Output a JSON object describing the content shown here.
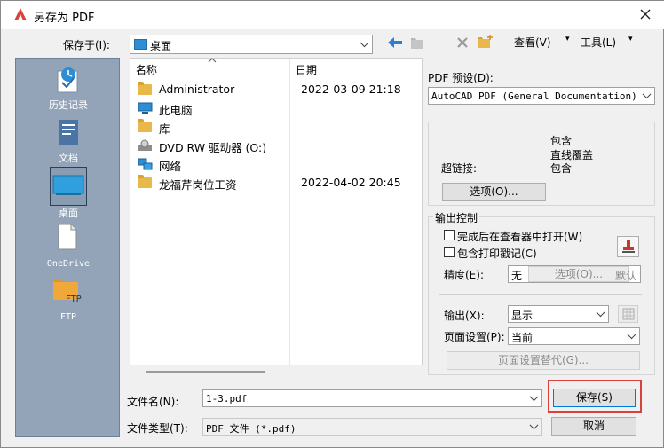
{
  "window": {
    "title": "另存为 PDF"
  },
  "toolbar": {
    "save_in_label": "保存于(I):",
    "location_value": "桌面",
    "view_menu": "查看(V)",
    "tools_menu": "工具(L)"
  },
  "places": [
    {
      "label": "历史记录",
      "icon": "history-icon"
    },
    {
      "label": "文档",
      "icon": "documents-icon"
    },
    {
      "label": "桌面",
      "icon": "desktop-icon"
    },
    {
      "label": "OneDrive",
      "icon": "onedrive-icon"
    },
    {
      "label": "FTP",
      "icon": "ftp-folder-icon"
    }
  ],
  "places_ftp_overlay": "FTP",
  "filelist": {
    "columns": {
      "name": "名称",
      "date": "日期"
    },
    "items": [
      {
        "name": "Administrator",
        "date": "2022-03-09 21:18",
        "icon": "folder-icon"
      },
      {
        "name": "此电脑",
        "date": "",
        "icon": "computer-icon"
      },
      {
        "name": "库",
        "date": "",
        "icon": "folder-icon"
      },
      {
        "name": "DVD RW 驱动器 (O:)",
        "date": "",
        "icon": "dvd-drive-icon"
      },
      {
        "name": "网络",
        "date": "",
        "icon": "network-icon"
      },
      {
        "name": "龙福芹岗位工资",
        "date": "2022-04-02 20:45",
        "icon": "folder-icon"
      }
    ]
  },
  "pdf": {
    "preset_label": "PDF 预设(D):",
    "preset_value": "AutoCAD PDF (General Documentation)",
    "info_line1": "包含",
    "info_line2": "直线覆盖",
    "info_line3": "包含",
    "hyperlink_label": "超链接:",
    "options_button": "选项(O)..."
  },
  "output_control": {
    "title": "输出控制",
    "open_in_viewer": "完成后在查看器中打开(W)",
    "include_plot_stamp": "包含打印戳记(C)",
    "precision_label": "精度(E):",
    "precision_value": "无",
    "precision_options_button": "选项(O)...",
    "precision_overlay": "默认",
    "output_label": "输出(X):",
    "output_value": "显示",
    "page_setup_label": "页面设置(P):",
    "page_setup_value": "当前",
    "page_setup_override_button": "页面设置替代(G)..."
  },
  "bottom": {
    "filename_label": "文件名(N):",
    "filename_value": "1-3.pdf",
    "filetype_label": "文件类型(T):",
    "filetype_value": "PDF 文件 (*.pdf)",
    "save_button": "保存(S)",
    "cancel_button": "取消"
  },
  "colors": {
    "accent": "#d9413b",
    "places_bg": "#93a4b8",
    "selection": "#2e8ed3"
  }
}
